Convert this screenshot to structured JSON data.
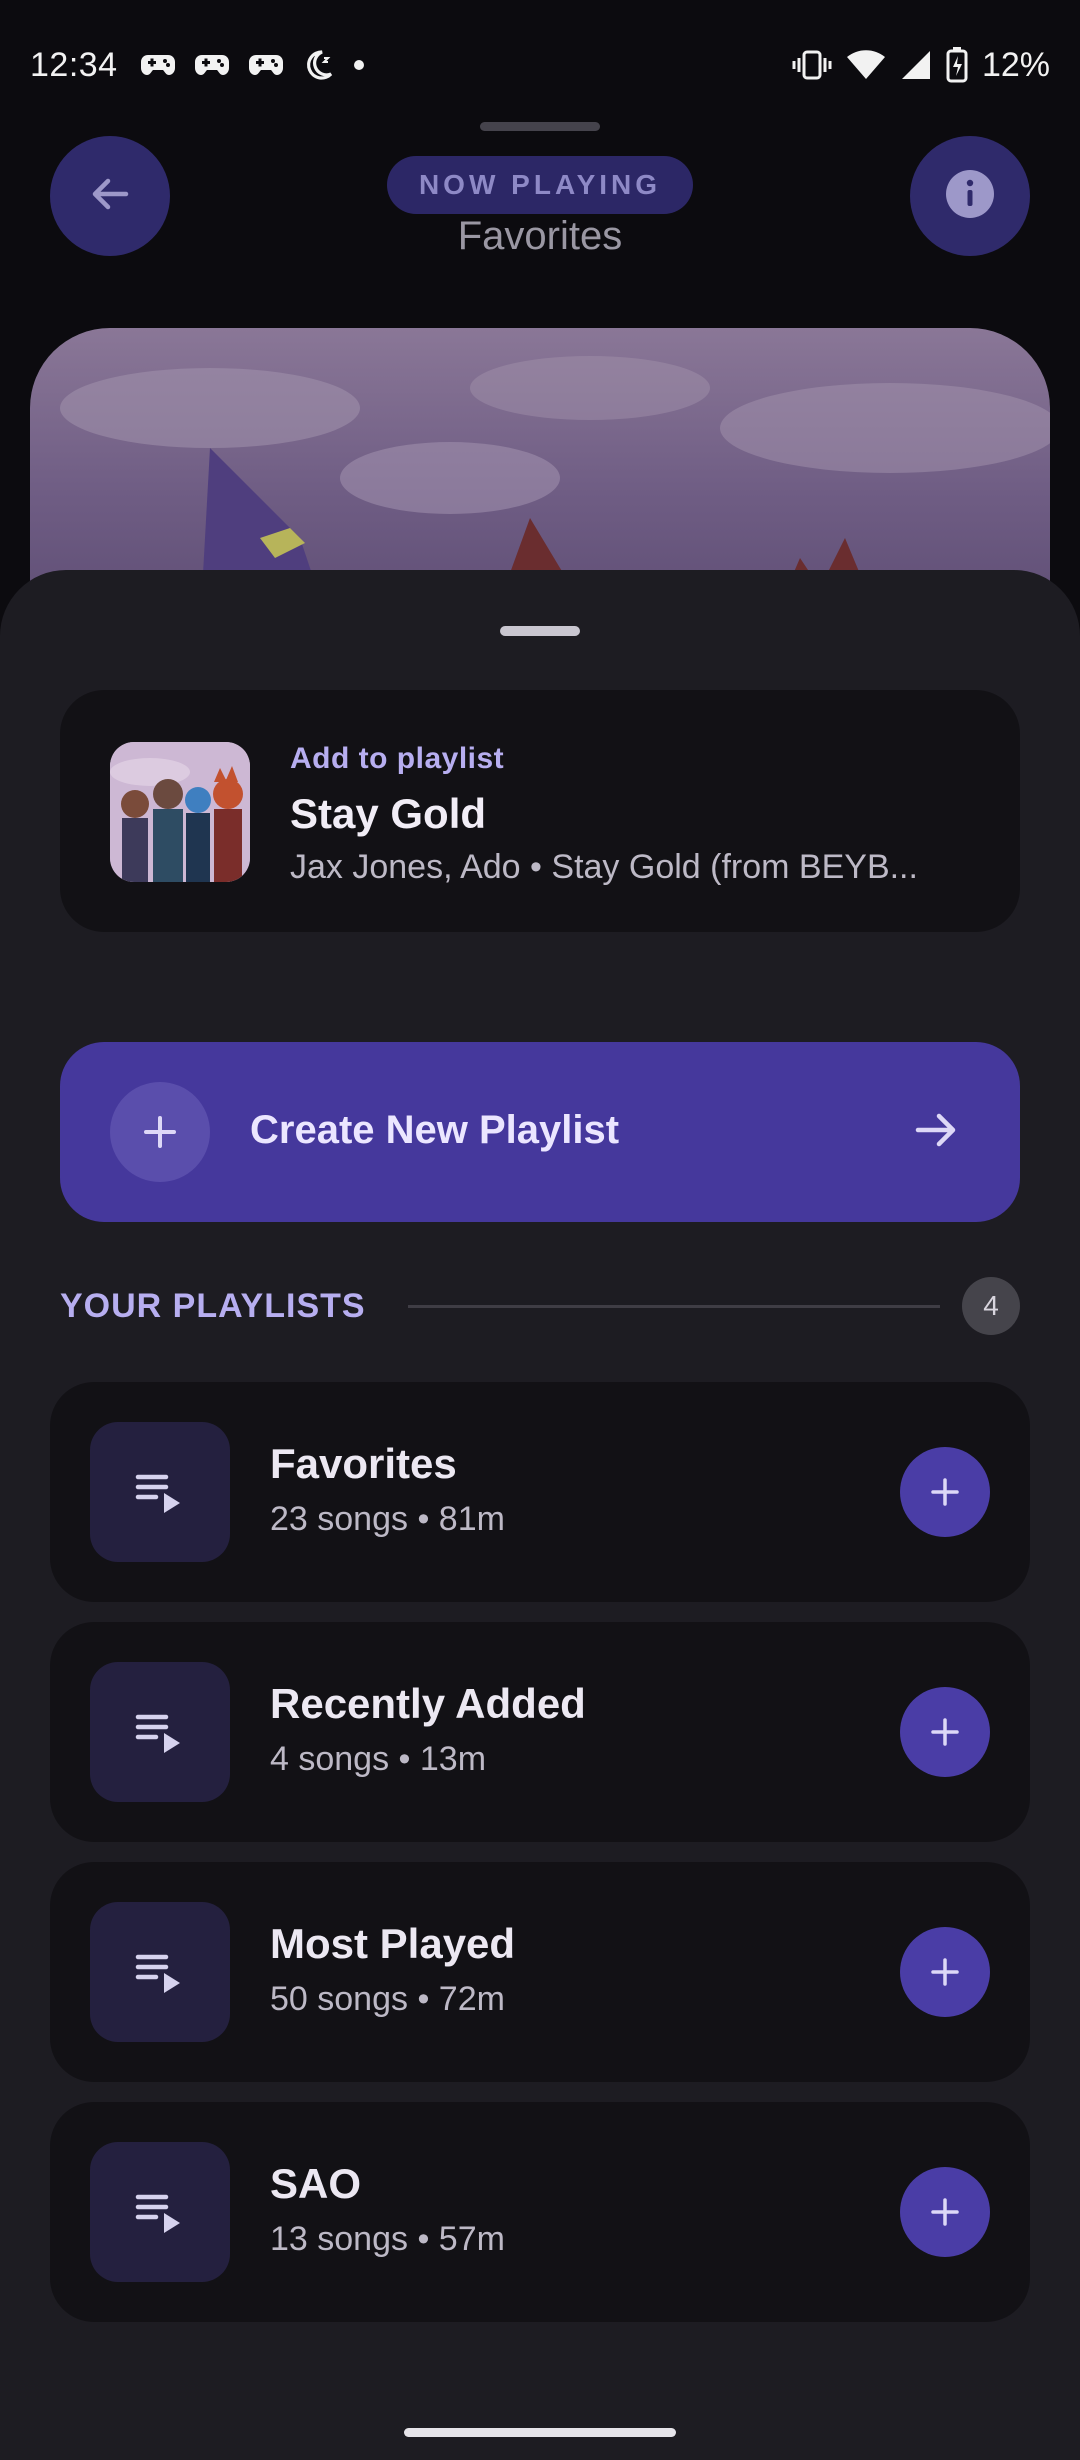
{
  "status_bar": {
    "time": "12:34",
    "battery": "12%",
    "icons_left": [
      "game-controller-icon",
      "game-controller-icon",
      "game-controller-icon",
      "do-not-disturb-moon-icon",
      "dot-icon"
    ],
    "icons_right": [
      "vibrate-icon",
      "wifi-icon",
      "signal-icon",
      "battery-charging-icon"
    ]
  },
  "header": {
    "chip": "NOW PLAYING",
    "title": "Favorites"
  },
  "sheet": {
    "song": {
      "kicker": "Add to playlist",
      "title": "Stay Gold",
      "subtitle": "Jax Jones, Ado • Stay Gold (from BEYB..."
    },
    "create_button": {
      "label": "Create New Playlist"
    },
    "section": {
      "title": "YOUR PLAYLISTS",
      "count": "4"
    },
    "playlists": [
      {
        "name": "Favorites",
        "meta": "23 songs • 81m"
      },
      {
        "name": "Recently Added",
        "meta": "4 songs • 13m"
      },
      {
        "name": "Most Played",
        "meta": "50 songs • 72m"
      },
      {
        "name": "SAO",
        "meta": "13 songs • 57m"
      }
    ]
  },
  "colors": {
    "accent": "#45389c",
    "accent_text": "#b7aef0",
    "background": "#0c0b0f",
    "sheet": "#1d1c22",
    "card": "#121115"
  }
}
